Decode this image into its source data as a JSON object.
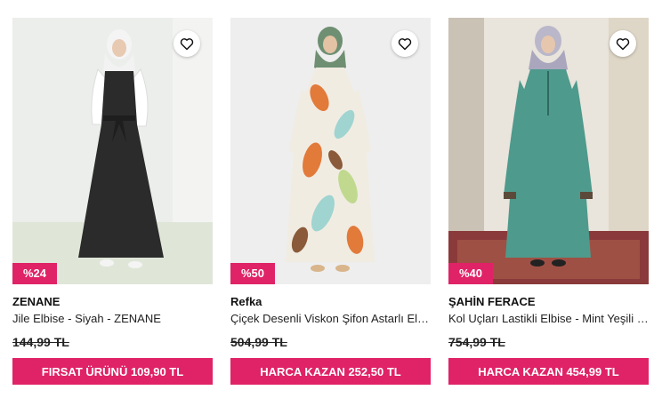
{
  "products": [
    {
      "badge": "%24",
      "brand": "ZENANE",
      "name": "Jile Elbise - Siyah - ZENANE",
      "old_price": "144,99 TL",
      "cta": "FIRSAT ÜRÜNÜ 109,90 TL",
      "icons": {
        "favorite": "heart-outline-icon"
      },
      "colors": {
        "dress": "#2b2b2b",
        "background": "#e9ece6"
      }
    },
    {
      "badge": "%50",
      "brand": "Refka",
      "name": "Çiçek Desenli Viskon Şifon Astarlı Elbise",
      "old_price": "504,99 TL",
      "cta": "HARCA KAZAN 252,50 TL",
      "icons": {
        "favorite": "heart-outline-icon"
      },
      "colors": {
        "dress": "#e27a3a",
        "background": "#ececec"
      }
    },
    {
      "badge": "%40",
      "brand": "ŞAHİN FERACE",
      "name": "Kol Uçları Lastikli Elbise - Mint Yeşili - Şahin Ferace",
      "old_price": "754,99 TL",
      "cta": "HARCA KAZAN 454,99 TL",
      "icons": {
        "favorite": "heart-outline-icon"
      },
      "colors": {
        "dress": "#4e9a8c",
        "background": "#8a7a6a"
      }
    }
  ],
  "colors": {
    "accent": "#e02266"
  }
}
